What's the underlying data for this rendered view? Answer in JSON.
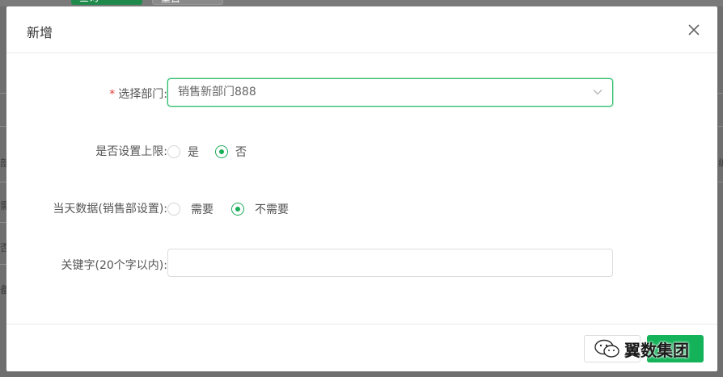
{
  "background": {
    "query_button": "查询",
    "reset_button": "重置",
    "left_edge_chars": [
      "部",
      "需",
      "否",
      "备"
    ],
    "right_edge_chars": [
      "编"
    ]
  },
  "dialog": {
    "title": "新增",
    "close_icon": "close-icon",
    "fields": {
      "department": {
        "label": "选择部门:",
        "required_mark": "*",
        "value": "销售新部门888",
        "icon": "chevron-down-icon"
      },
      "set_limit": {
        "label": "是否设置上限:",
        "options": [
          "是",
          "否"
        ],
        "selected": "否"
      },
      "today_data": {
        "label": "当天数据(销售部设置):",
        "options": [
          "需要",
          "不需要"
        ],
        "selected": "不需要"
      },
      "keywords": {
        "label": "关键字(20个字以内):",
        "value": "",
        "placeholder": ""
      }
    },
    "footer": {
      "watermark_text": "翼数集团"
    }
  },
  "colors": {
    "accent": "#1aad5a",
    "required": "#e23c3c",
    "overlay": "#6f6f6f"
  }
}
